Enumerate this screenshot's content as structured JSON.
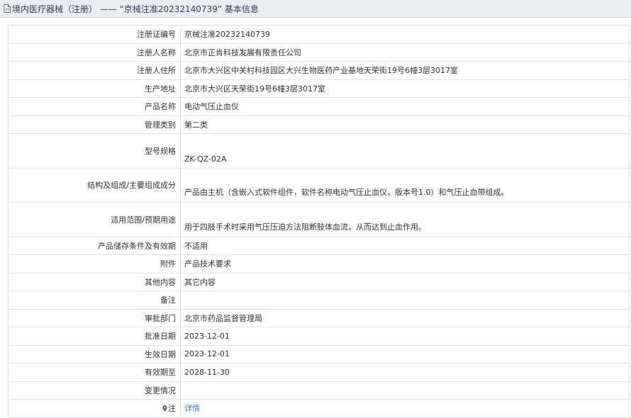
{
  "header": {
    "title": "境内医疗器械（注册） —— “京械注准20232140739” 基本信息"
  },
  "rows": [
    {
      "label": "注册证编号",
      "value": "京械注准20232140739"
    },
    {
      "label": "注册人名称",
      "value": "北京市正肯科技发展有限责任公司"
    },
    {
      "label": "注册人住所",
      "value": "北京市大兴区中关村科技园区大兴生物医药产业基地天荣街19号6幢3层3017室"
    },
    {
      "label": "生产地址",
      "value": "北京市大兴区天荣街19号6幢3层3017室"
    },
    {
      "label": "产品名称",
      "value": "电动气压止血仪"
    },
    {
      "label": "管理类别",
      "value": "第二类"
    },
    {
      "label": "型号规格",
      "value": "ZK-QZ-02A"
    },
    {
      "label": "结构及组成/主要组成成分",
      "value": "产品由主机（含嵌入式软件组件，软件名称电动气压止血仪，版本号1.0）和气压止血带组成。"
    },
    {
      "label": "适用范围/预期用途",
      "value": "用于四肢手术时采用气压压迫方法阻断肢体血流，从而达到止血作用。"
    },
    {
      "label": "产品储存条件及有效期",
      "value": "不适用"
    },
    {
      "label": "附件",
      "value": "产品技术要求"
    },
    {
      "label": "其他内容",
      "value": "其它内容"
    },
    {
      "label": "备注",
      "value": ""
    },
    {
      "label": "审批部门",
      "value": "北京市药品监督管理局"
    },
    {
      "label": "批准日期",
      "value": "2023-12-01"
    },
    {
      "label": "生效日期",
      "value": "2023-12-01"
    },
    {
      "label": "有效期至",
      "value": "2028-11-30"
    },
    {
      "label": "变更情况",
      "value": ""
    },
    {
      "label": "注",
      "value": "详情"
    }
  ],
  "icons": {
    "header": "document-icon",
    "note": "map-pin-icon"
  },
  "colors": {
    "header_bg": "#e9edf2",
    "border": "#dfe3e8",
    "link": "#3c7fc1"
  }
}
